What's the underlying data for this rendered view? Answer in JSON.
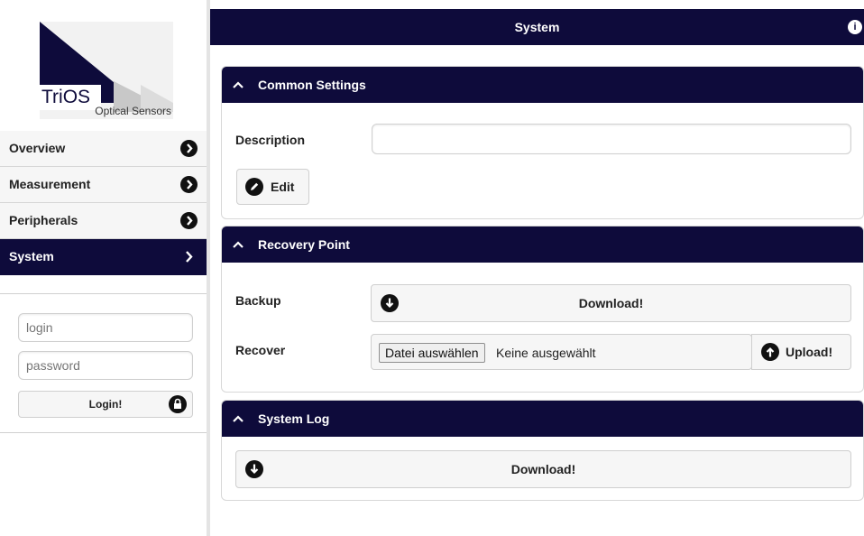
{
  "logo": {
    "brand": "TriOS",
    "tagline": "Optical Sensors"
  },
  "sidebar": {
    "items": [
      {
        "label": "Overview"
      },
      {
        "label": "Measurement"
      },
      {
        "label": "Peripherals"
      },
      {
        "label": "System",
        "active": true
      }
    ]
  },
  "login": {
    "login_placeholder": "login",
    "password_placeholder": "password",
    "button_label": "Login!"
  },
  "header": {
    "title": "System",
    "info_icon": "i"
  },
  "common_settings": {
    "title": "Common Settings",
    "description_label": "Description",
    "description_value": "",
    "edit_label": "Edit"
  },
  "recovery_point": {
    "title": "Recovery Point",
    "backup_label": "Backup",
    "download_label": "Download!",
    "recover_label": "Recover",
    "file_button_label": "Datei auswählen",
    "file_status": "Keine ausgewählt",
    "upload_label": "Upload!"
  },
  "system_log": {
    "title": "System Log",
    "download_label": "Download!"
  },
  "colors": {
    "brand_dark": "#0e0b3b",
    "panel_border": "#d8d8d8",
    "button_bg": "#f6f6f6"
  }
}
